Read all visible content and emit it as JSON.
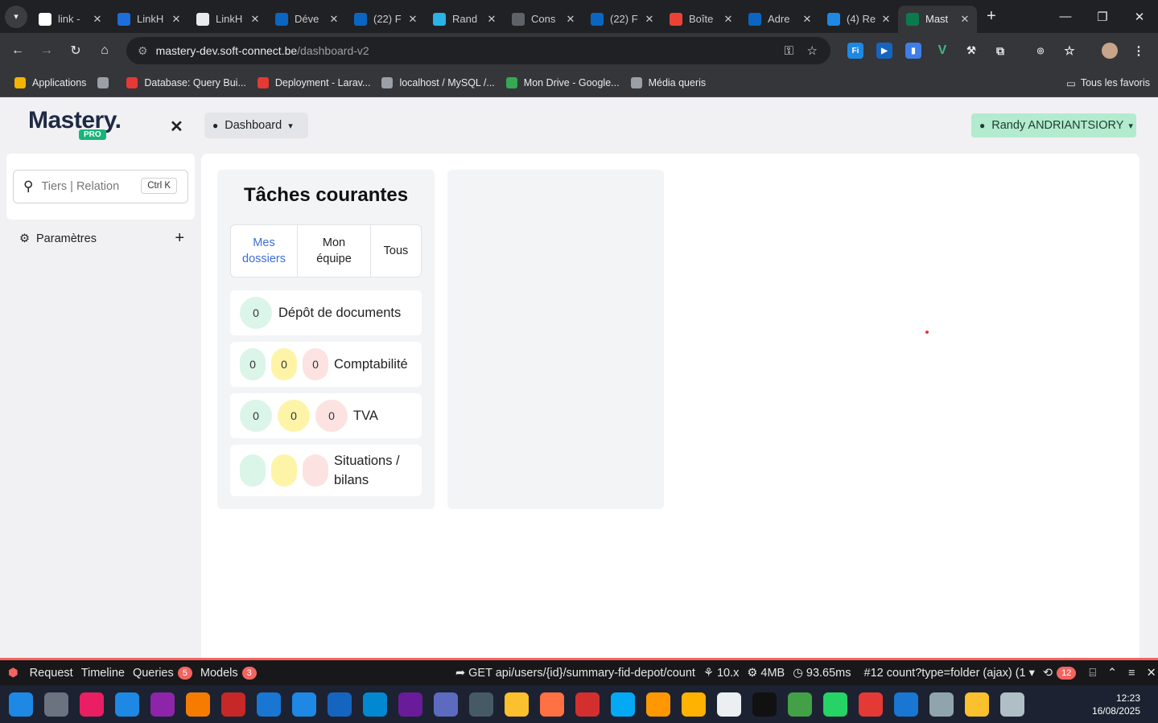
{
  "browser": {
    "tabs": [
      {
        "title": "link -",
        "icon": "google-icon",
        "color": "#ffffff"
      },
      {
        "title": "LinkH",
        "icon": "linkhub-icon",
        "color": "#1d6ddc"
      },
      {
        "title": "LinkH",
        "icon": "image-icon",
        "color": "#e8eaed"
      },
      {
        "title": "Déve",
        "icon": "linkedin-icon",
        "color": "#0a66c2"
      },
      {
        "title": "(22) F",
        "icon": "linkedin-icon",
        "color": "#0a66c2"
      },
      {
        "title": "Rand",
        "icon": "card-icon",
        "color": "#2bb3e6"
      },
      {
        "title": "Cons",
        "icon": "openai-icon",
        "color": "#5f6368"
      },
      {
        "title": "(22) F",
        "icon": "linkedin-icon",
        "color": "#0a66c2"
      },
      {
        "title": "Boîte",
        "icon": "gmail-icon",
        "color": "#ea4335"
      },
      {
        "title": "Adre",
        "icon": "linkedin-icon",
        "color": "#0a66c2"
      },
      {
        "title": "(4) Re",
        "icon": "feather-icon",
        "color": "#1e88e5"
      },
      {
        "title": "Mast",
        "icon": "mastery-icon",
        "color": "#0c7a4c"
      }
    ],
    "url_host": "mastery-dev.soft-connect.be",
    "url_path": "/dashboard-v2",
    "bookmarks": [
      {
        "label": "Applications",
        "color": "#f4b400"
      },
      {
        "label": "",
        "color": "#9aa0a6"
      },
      {
        "label": "Database: Query Bui...",
        "color": "#e53935"
      },
      {
        "label": "Deployment - Larav...",
        "color": "#e53935"
      },
      {
        "label": "localhost / MySQL /...",
        "color": "#9aa0a6"
      },
      {
        "label": "Mon Drive - Google...",
        "color": "#34a853"
      },
      {
        "label": "Média queris",
        "color": "#9aa0a6"
      }
    ],
    "all_bookmarks": "Tous les favoris"
  },
  "app": {
    "logo_text": "Mastery.",
    "logo_badge": "PRO",
    "dashboard_label": "Dashboard",
    "user_label": "Randy ANDRIANTSIORY",
    "search_placeholder": "Tiers | Relation",
    "search_shortcut": "Ctrl K",
    "params_label": "Paramètres",
    "card_title": "Tâches courantes",
    "tabs": [
      {
        "label": "Mes dossiers"
      },
      {
        "label": "Mon équipe"
      },
      {
        "label": "Tous"
      }
    ],
    "rows": [
      {
        "label": "Dépôt de documents",
        "g": "0",
        "y": "",
        "r": ""
      },
      {
        "label": "Comptabilité",
        "g": "0",
        "y": "0",
        "r": "0"
      },
      {
        "label": "TVA",
        "g": "0",
        "y": "0",
        "r": "0"
      },
      {
        "label": "Situations / bilans",
        "g": "",
        "y": "",
        "r": ""
      }
    ]
  },
  "debugbar": {
    "request": "Request",
    "timeline": "Timeline",
    "queries": "Queries",
    "queries_count": "5",
    "models": "Models",
    "models_count": "3",
    "route": "GET api/users/{id}/summary-fid-depot/count",
    "version": "10.x",
    "memory": "4MB",
    "time": "93.65ms",
    "ajax": "#12 count?type=folder (ajax) (1",
    "history_count": "12"
  },
  "taskbar": {
    "time": "12:23",
    "date": "16/08/2025"
  }
}
